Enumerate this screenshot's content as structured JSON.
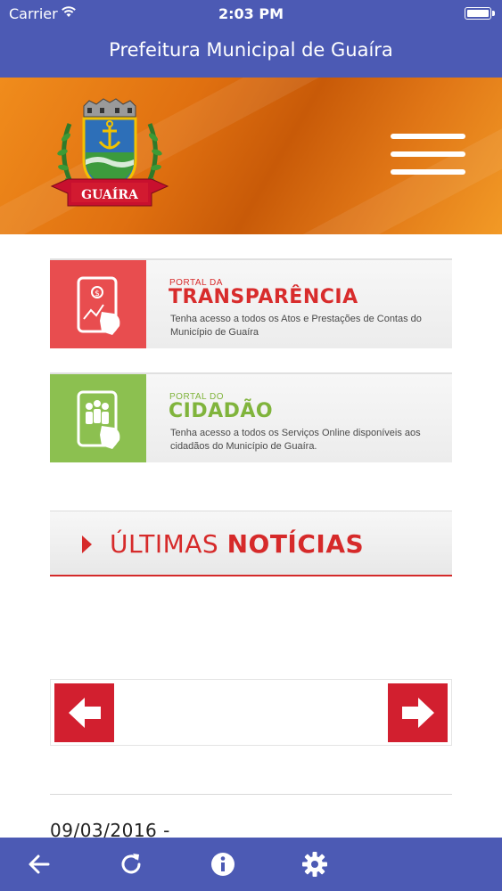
{
  "status_bar": {
    "carrier": "Carrier",
    "time": "2:03 PM"
  },
  "nav": {
    "title": "Prefeitura Municipal de Guaíra"
  },
  "hero": {
    "crest_label": "GUAÍRA",
    "menu_icon": "hamburger-menu-icon"
  },
  "portals": [
    {
      "kicker": "PORTAL DA",
      "name": "TRANSPARÊNCIA",
      "description": "Tenha acesso a todos os Atos e Prestações de Contas do Município de Guaíra",
      "accent": "#e84d4f",
      "name_color": "#d82c2c",
      "icon": "transparency-tablet-icon"
    },
    {
      "kicker": "PORTAL DO",
      "name": "CIDADÃO",
      "description": "Tenha acesso a todos os Serviços Online disponíveis aos cidadãos do Município de Guaíra.",
      "accent": "#8cc050",
      "name_color": "#80b43c",
      "icon": "citizen-tablet-icon"
    }
  ],
  "news": {
    "title_light": "ÚLTIMAS ",
    "title_bold": "NOTÍCIAS",
    "accent": "#d62a2a"
  },
  "carousel": {
    "prev_icon": "arrow-left-icon",
    "next_icon": "arrow-right-icon",
    "button_color": "#d21f2f"
  },
  "latest_item": {
    "date": "09/03/2016 -"
  },
  "toolbar": {
    "icons": [
      "back-arrow-icon",
      "refresh-icon",
      "info-icon",
      "settings-gear-icon"
    ]
  },
  "colors": {
    "bar": "#4c5ab4",
    "hero_orange": "#e07010"
  }
}
